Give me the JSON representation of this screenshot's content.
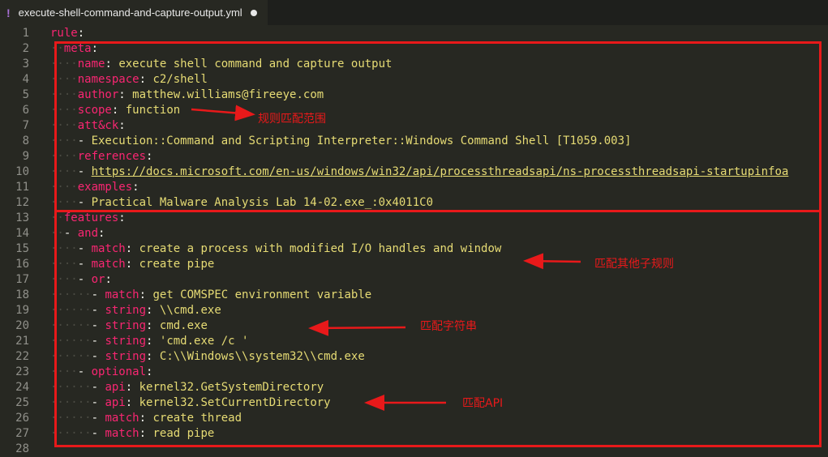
{
  "tab": {
    "icon": "yaml-exclamation-icon",
    "bang": "!",
    "filename": "execute-shell-command-and-capture-output.yml",
    "modified": true
  },
  "lines": [
    {
      "indent": "",
      "dash": false,
      "key": "rule",
      "value": ""
    },
    {
      "indent": "  ",
      "dash": false,
      "key": "meta",
      "value": ""
    },
    {
      "indent": "    ",
      "dash": false,
      "key": "name",
      "value": "execute shell command and capture output"
    },
    {
      "indent": "    ",
      "dash": false,
      "key": "namespace",
      "value": "c2/shell"
    },
    {
      "indent": "    ",
      "dash": false,
      "key": "author",
      "value": "matthew.williams@fireeye.com"
    },
    {
      "indent": "    ",
      "dash": false,
      "key": "scope",
      "value": "function"
    },
    {
      "indent": "    ",
      "dash": false,
      "key": "att&ck",
      "value": ""
    },
    {
      "indent": "      ",
      "dash": true,
      "key": "",
      "value": "Execution::Command and Scripting Interpreter::Windows Command Shell [T1059.003]"
    },
    {
      "indent": "    ",
      "dash": false,
      "key": "references",
      "value": ""
    },
    {
      "indent": "      ",
      "dash": true,
      "key": "",
      "value": "https://docs.microsoft.com/en-us/windows/win32/api/processthreadsapi/ns-processthreadsapi-startupinfoa",
      "url": true
    },
    {
      "indent": "    ",
      "dash": false,
      "key": "examples",
      "value": ""
    },
    {
      "indent": "      ",
      "dash": true,
      "key": "",
      "value": "Practical Malware Analysis Lab 14-02.exe_:0x4011C0"
    },
    {
      "indent": "  ",
      "dash": false,
      "key": "features",
      "value": ""
    },
    {
      "indent": "    ",
      "dash": true,
      "key": "and",
      "value": ""
    },
    {
      "indent": "      ",
      "dash": true,
      "key": "match",
      "value": "create a process with modified I/O handles and window"
    },
    {
      "indent": "      ",
      "dash": true,
      "key": "match",
      "value": "create pipe"
    },
    {
      "indent": "      ",
      "dash": true,
      "key": "or",
      "value": ""
    },
    {
      "indent": "        ",
      "dash": true,
      "key": "match",
      "value": "get COMSPEC environment variable"
    },
    {
      "indent": "        ",
      "dash": true,
      "key": "string",
      "value": "\\\\cmd.exe"
    },
    {
      "indent": "        ",
      "dash": true,
      "key": "string",
      "value": "cmd.exe"
    },
    {
      "indent": "        ",
      "dash": true,
      "key": "string",
      "value": "'cmd.exe /c '"
    },
    {
      "indent": "        ",
      "dash": true,
      "key": "string",
      "value": "C:\\\\Windows\\\\system32\\\\cmd.exe"
    },
    {
      "indent": "      ",
      "dash": true,
      "key": "optional",
      "value": ""
    },
    {
      "indent": "        ",
      "dash": true,
      "key": "api",
      "value": "kernel32.GetSystemDirectory"
    },
    {
      "indent": "        ",
      "dash": true,
      "key": "api",
      "value": "kernel32.SetCurrentDirectory"
    },
    {
      "indent": "        ",
      "dash": true,
      "key": "match",
      "value": "create thread"
    },
    {
      "indent": "        ",
      "dash": true,
      "key": "match",
      "value": "read pipe"
    },
    {
      "indent": "",
      "dash": false,
      "key": "",
      "value": ""
    }
  ],
  "annotations": {
    "scope": "规则匹配范围",
    "subrules": "匹配其他子规则",
    "strings": "匹配字符串",
    "api": "匹配API",
    "color": "#e8191a"
  }
}
